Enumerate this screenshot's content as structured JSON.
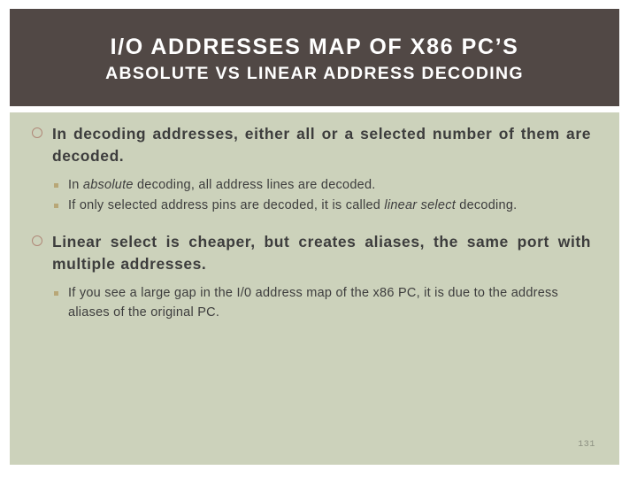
{
  "header": {
    "title": "I/O ADDRESSES MAP OF X86 PC’S",
    "subtitle": "ABSOLUTE VS LINEAR ADDRESS DECODING",
    "background_color": "#514845",
    "text_color": "#ffffff"
  },
  "body": {
    "background_color": "#ccd2bb",
    "text_color": "#3d3d3d",
    "bullet_ring_color": "#b08878",
    "bullet_square_color": "#b8a777",
    "blocks": [
      {
        "level1": "In decoding addresses, either all or a selected number of them are decoded.",
        "level2": [
          {
            "parts": [
              {
                "text": "In ",
                "italic": false
              },
              {
                "text": "absolute",
                "italic": true
              },
              {
                "text": " decoding, all address lines are decoded.",
                "italic": false
              }
            ]
          },
          {
            "parts": [
              {
                "text": "If only selected address pins are decoded, it is called ",
                "italic": false
              },
              {
                "text": "linear select",
                "italic": true
              },
              {
                "text": " decoding.",
                "italic": false
              }
            ]
          }
        ]
      },
      {
        "level1": "Linear select is cheaper, but creates aliases, the same port with multiple addresses.",
        "level2": [
          {
            "parts": [
              {
                "text": "If you see a large gap in the I/0 address map of the x86 PC, it is due to the address aliases of the original PC.",
                "italic": false
              }
            ]
          }
        ]
      }
    ]
  },
  "footer": {
    "page_number": "131"
  }
}
